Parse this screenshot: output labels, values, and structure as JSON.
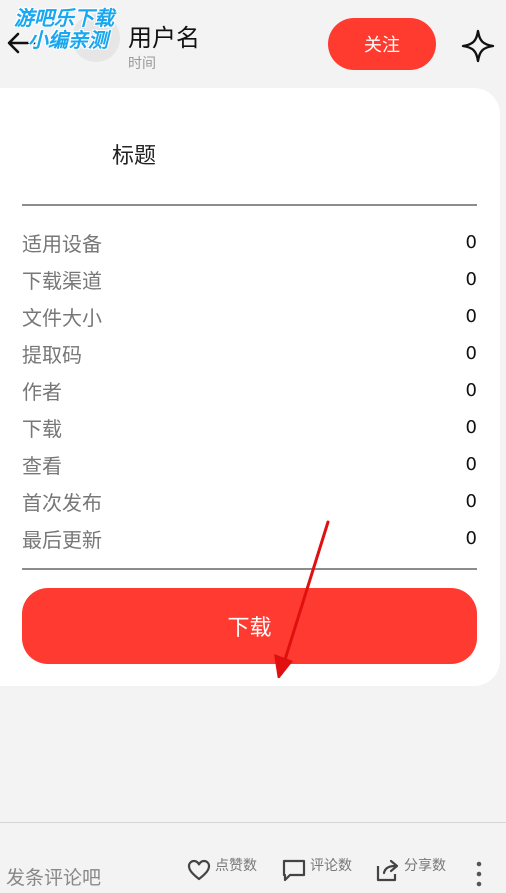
{
  "watermark": {
    "line1": "游吧乐下载",
    "line2": "小编亲测"
  },
  "header": {
    "username": "用户名",
    "time": "时间",
    "follow_label": "关注"
  },
  "card": {
    "title": "标题",
    "rows": [
      {
        "label": "适用设备",
        "value": "0"
      },
      {
        "label": "下载渠道",
        "value": "0"
      },
      {
        "label": "文件大小",
        "value": "0"
      },
      {
        "label": "提取码",
        "value": "0"
      },
      {
        "label": "作者",
        "value": "0"
      },
      {
        "label": "下载",
        "value": "0"
      },
      {
        "label": "查看",
        "value": "0"
      },
      {
        "label": "首次发布",
        "value": "0"
      },
      {
        "label": "最后更新",
        "value": "0"
      }
    ],
    "download_label": "下载"
  },
  "footer": {
    "comment_placeholder": "发条评论吧",
    "like_label": "点赞数",
    "comment_label": "评论数",
    "share_label": "分享数"
  },
  "colors": {
    "accent": "#ff3b30",
    "arrow": "#e01010",
    "watermark": "#18a7f0"
  },
  "icons": [
    "back-arrow-icon",
    "sparkle-star-icon",
    "heart-icon",
    "comment-bubble-icon",
    "share-icon",
    "more-vertical-icon"
  ]
}
